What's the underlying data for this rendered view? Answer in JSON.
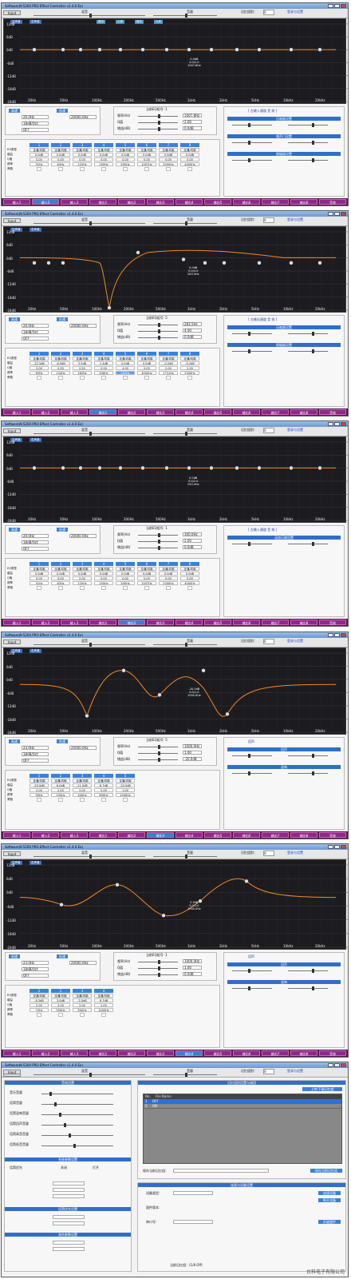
{
  "window_title": "Software(K-5200 PRO Effect Controller v1.4.0 Ex)",
  "toolbar": {
    "btn1": "Input",
    "btn2": "Output",
    "mix_label": "混音",
    "vol_label": "音量",
    "mute_label": "Mute",
    "channel_label": "记忆组别：",
    "channel_value": "0",
    "link": "登录与设置"
  },
  "axis_y": [
    "12dB",
    "6dB",
    "0dB",
    "-6dB",
    "-12dB",
    "-18dB",
    "-24dB"
  ],
  "axis_x": [
    "20Hz",
    "50Hz",
    "100Hz",
    "200Hz",
    "500Hz",
    "1kHz",
    "2kHz",
    "5kHz",
    "10kHz",
    "20kHz"
  ],
  "bottom_tabs": [
    "输入1",
    "输入2",
    "输入3",
    "输出1",
    "输出2",
    "输出3",
    "输出4",
    "输出5",
    "输出6",
    "输出7",
    "输出8",
    "音效"
  ],
  "screens": [
    {
      "tags": [
        "左声道",
        "右声道",
        "音乐",
        "人声",
        "音乐",
        "人声"
      ],
      "point_label": [
        "0.0dB",
        "0.0/2.0",
        "1007.8Hz"
      ],
      "hp_lp": {
        "hp": "高通",
        "lp": "低通",
        "freq_hp": "20.0Hz",
        "freq_lp": "20000.0Hz",
        "type": "OFF",
        "slope": "18dB/Oct"
      },
      "eq_title": "当前EQ组号: 1",
      "eq_rows": [
        [
          "频率(Hz)",
          "1007.8Hz"
        ],
        [
          "Q值",
          "2.00"
        ],
        [
          "增益(dB)",
          "0.0dB"
        ]
      ],
      "bands": [
        [
          "1",
          "全通/均衡",
          "0.0dB",
          "0.00",
          "31Hz"
        ],
        [
          "2",
          "全通/均衡",
          "0.0dB",
          "0.00",
          "63Hz"
        ],
        [
          "3",
          "全通/均衡",
          "0.0dB",
          "0.00",
          "125Hz"
        ],
        [
          "4",
          "全通/均衡",
          "0.0dB",
          "0.00",
          "250Hz"
        ],
        [
          "5",
          "全通/均衡",
          "0.0dB",
          "0.00",
          "500Hz"
        ],
        [
          "6",
          "全通/均衡",
          "0.0dB",
          "0.00",
          "1007Hz"
        ],
        [
          "7",
          "全通/均衡",
          "0.0dB",
          "0.00",
          "2000Hz"
        ],
        [
          "8",
          "全通/均衡",
          "0.0dB",
          "0.00",
          "4000Hz"
        ]
      ],
      "band_row_labels": [
        "EQ类型",
        "增益",
        "Q值",
        "频率",
        "旁路"
      ],
      "right_title": "[ 左输入通道 音 效 ]",
      "right_sections": [
        "压缩器设置",
        "噪声门设置",
        "限幅器设置"
      ],
      "active_tab": 1
    },
    {
      "tags": [
        "左声道",
        "右声道"
      ],
      "point_label": [
        "0.0dB",
        "0.0/4.0",
        "283.5Hz"
      ],
      "hp_lp": {
        "hp": "高通",
        "lp": "低通",
        "freq_hp": "20.0Hz",
        "freq_lp": "20000.0Hz",
        "type": "OFF",
        "slope": "18dB/Oct"
      },
      "eq_title": "当前EQ组号: 5",
      "eq_rows": [
        [
          "频率(Hz)",
          "283.5Hz"
        ],
        [
          "Q值",
          "4.00"
        ],
        [
          "增益(dB)",
          "0.0dB"
        ]
      ],
      "bands": [
        [
          "1",
          "全通/均衡",
          "-22.5dB",
          "5.00",
          "65Hz"
        ],
        [
          "2",
          "全通/均衡",
          "-6.0dB",
          "0.50",
          "104Hz"
        ],
        [
          "3",
          "全通/均衡",
          "3.5dB",
          "0.50",
          "183Hz"
        ],
        [
          "4",
          "全通/均衡",
          "1.4dB",
          "0.50",
          "406Hz"
        ],
        [
          "5",
          "全通/均衡",
          "0.0dB",
          "4.00",
          "283Hz"
        ],
        [
          "6",
          "全通/均衡",
          "0.0dB",
          "0.00",
          "4000Hz"
        ],
        [
          "7",
          "全通/均衡",
          "-0.2dB",
          "2.00",
          "1731Hz"
        ],
        [
          "8",
          "全通/均衡",
          "-0.2dB",
          "2.00",
          "2300Hz"
        ]
      ],
      "band_row_labels": [
        "EQ类型",
        "增益",
        "Q值",
        "频率",
        "旁路"
      ],
      "right_title": "[ 左输出通道 音 效 ]",
      "right_sections": [
        "压缩器设置",
        "限幅器设置"
      ],
      "active_tab": 3
    },
    {
      "tags": [
        "左声道",
        "右声道"
      ],
      "point_label": [
        "0.0dB",
        "0.0/2.0",
        "250.0Hz"
      ],
      "hp_lp": {
        "hp": "高通",
        "lp": "低通",
        "freq_hp": "20.0Hz",
        "freq_lp": "20000.0Hz",
        "type": "OFF",
        "slope": "18dB/Oct"
      },
      "eq_title": "当前EQ组号: 1",
      "eq_rows": [
        [
          "频率(Hz)",
          "300.0Hz"
        ],
        [
          "Q值",
          "2.00"
        ],
        [
          "增益(dB)",
          "0.0dB"
        ]
      ],
      "bands": [
        [
          "1",
          "全通/均衡",
          "0.0dB",
          "0.00",
          "31Hz"
        ],
        [
          "2",
          "全通/均衡",
          "0.0dB",
          "0.00",
          "63Hz"
        ],
        [
          "3",
          "全通/均衡",
          "0.0dB",
          "0.00",
          "125Hz"
        ],
        [
          "4",
          "全通/均衡",
          "0.0dB",
          "0.00",
          "250Hz"
        ],
        [
          "5",
          "全通/均衡",
          "0.0dB",
          "0.00",
          "500Hz"
        ],
        [
          "6",
          "全通/均衡",
          "0.0dB",
          "0.00",
          "1007Hz"
        ],
        [
          "7",
          "全通/均衡",
          "0.0dB",
          "0.00",
          "2000Hz"
        ],
        [
          "8",
          "全通/均衡",
          "0.0dB",
          "0.00",
          "4000Hz"
        ]
      ],
      "band_row_labels": [
        "EQ类型",
        "增益",
        "Q值",
        "频率",
        "旁路"
      ],
      "right_title": "[ 左输入通道 音 效 ]",
      "right_sections": [
        "动态压缩设置"
      ],
      "active_tab": 4
    },
    {
      "tags": [
        "左声道",
        "右声道"
      ],
      "point_label": [
        "-20.0dB",
        "0.0/1.0",
        "1000.0Hz"
      ],
      "hp_lp": {
        "hp": "高通",
        "lp": "低通",
        "freq_hp": "23.0Hz",
        "freq_lp": "20000.0Hz",
        "type": "OFF",
        "slope": "18dB/Oct"
      },
      "eq_title": "当前EQ组号: 5",
      "eq_rows": [
        [
          "频率(Hz)",
          "1000.0Hz"
        ],
        [
          "Q值",
          "1.00"
        ],
        [
          "增益(dB)",
          "-20.0dB"
        ]
      ],
      "bands": [
        [
          "1",
          "全通/均衡",
          "-20.0dB",
          "2.00",
          "50Hz"
        ],
        [
          "2",
          "全通/均衡",
          "6.0dB",
          "2.00",
          "150Hz"
        ],
        [
          "3",
          "全通/均衡",
          "-11.0dB",
          "2.00",
          "400Hz"
        ],
        [
          "4",
          "全通/均衡",
          "6.7dB",
          "2.00",
          "600Hz"
        ],
        [
          "5",
          "全通/均衡",
          "-20.0dB",
          "1.00",
          "1000Hz"
        ]
      ],
      "band_row_labels": [
        "EQ类型",
        "增益",
        "Q值",
        "频率",
        "旁路"
      ],
      "right_title": "回声",
      "right_sections": [
        "回声",
        "混响"
      ],
      "active_tab": 5
    },
    {
      "tags": [
        "左声道",
        "右声道"
      ],
      "point_label": [
        "0.0dB",
        "0.0/1.0",
        "1000.0Hz"
      ],
      "hp_lp": {
        "hp": "高通",
        "lp": "低通",
        "freq_hp": "23.0Hz",
        "freq_lp": "20000.0Hz",
        "type": "OFF",
        "slope": "18dB/Oct"
      },
      "eq_title": "当前EQ组号: 1",
      "eq_rows": [
        [
          "频率(Hz)",
          "1000.0Hz"
        ],
        [
          "Q值",
          "1.00"
        ],
        [
          "增益(dB)",
          "0.0dB"
        ]
      ],
      "bands": [
        [
          "1",
          "全通/均衡",
          "-6.5dB",
          "2.00",
          "75Hz"
        ],
        [
          "2",
          "全通/均衡",
          "3.0dB",
          "2.00",
          "350Hz"
        ],
        [
          "3",
          "全通/均衡",
          "-5.0dB",
          "2.00",
          "500Hz"
        ],
        [
          "4",
          "全通/均衡",
          "6.7dB",
          "1.00",
          "1000Hz"
        ]
      ],
      "band_row_labels": [
        "EQ类型",
        "增益",
        "Q值",
        "频率",
        "旁路"
      ],
      "right_title": "回声",
      "right_sections": [
        "回声",
        "混响"
      ],
      "active_tab": 6
    }
  ],
  "last": {
    "sections": [
      "音效设置",
      "系统参数设置",
      "话筒优先设置",
      "其他参数设置"
    ],
    "left_rows": [
      "音乐音量",
      "话筒音量",
      "话筒混响音量",
      "话筒回声音量",
      "话筒高音音量",
      "话筒低音音量"
    ],
    "mic_label": "话筒优先",
    "mic_opts": [
      "关闭",
      "打开"
    ],
    "list_title": "记忆组别设置与调用",
    "list_btn": "上传/下载记忆组",
    "list_head": [
      "No.",
      "File Name"
    ],
    "list_rows": [
      [
        "1",
        "OFF"
      ],
      [
        "2",
        "ON"
      ]
    ],
    "save_label": "保存当前记忆组：",
    "save_btn": "保存当前记忆组",
    "conn_title": "连接与设备设置",
    "conn_rows": [
      "设备类型：",
      "固件版本：",
      "串口号："
    ],
    "conn_btns": [
      "连接设备",
      "断开设备",
      "升级固件"
    ],
    "bottom_info": "当前记忆组：(1/8 Off)",
    "watermark": "台科电子有限公司"
  }
}
